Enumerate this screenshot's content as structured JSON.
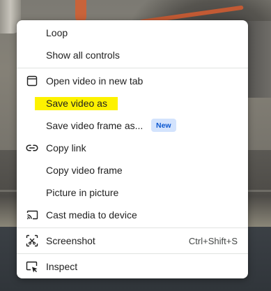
{
  "menu": {
    "loop_label": "Loop",
    "show_all_controls_label": "Show all controls",
    "open_video_new_tab_label": "Open video in new tab",
    "save_video_as_label": "Save video as",
    "save_video_frame_as_label": "Save video frame as...",
    "new_badge": "New",
    "copy_link_label": "Copy link",
    "copy_video_frame_label": "Copy video frame",
    "picture_in_picture_label": "Picture in picture",
    "cast_media_label": "Cast media to device",
    "screenshot_label": "Screenshot",
    "screenshot_shortcut": "Ctrl+Shift+S",
    "inspect_label": "Inspect"
  },
  "icons": {
    "open_video_new_tab": "new-tab-icon",
    "copy_link": "link-icon",
    "cast_media": "cast-icon",
    "screenshot": "screenshot-icon",
    "inspect": "inspect-icon"
  },
  "colors": {
    "highlight": "#fdf200",
    "badge_bg": "#d3e3fd",
    "badge_text": "#0b57d0",
    "menu_bg": "#ffffff",
    "separator": "#e1e3e1"
  }
}
